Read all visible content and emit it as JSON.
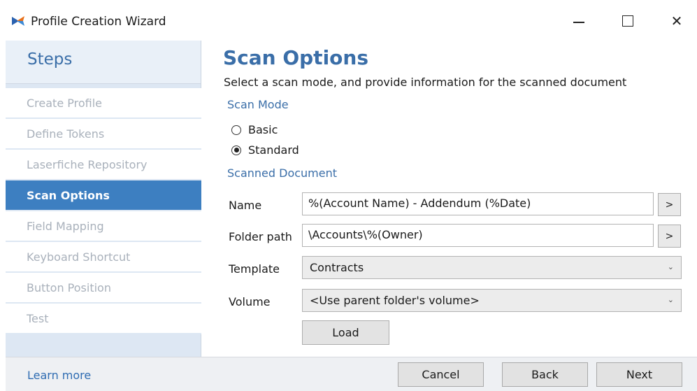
{
  "window": {
    "title": "Profile Creation Wizard",
    "icon": "laserfiche-logo-icon",
    "controls": [
      "minimize-icon",
      "maximize-icon",
      "close-icon"
    ],
    "close_glyph": "✕"
  },
  "steps": {
    "title": "Steps",
    "items": [
      {
        "label": "Create Profile",
        "active": false
      },
      {
        "label": "Define Tokens",
        "active": false
      },
      {
        "label": "Laserfiche Repository",
        "active": false
      },
      {
        "label": "Scan Options",
        "active": true
      },
      {
        "label": "Field Mapping",
        "active": false
      },
      {
        "label": "Keyboard Shortcut",
        "active": false
      },
      {
        "label": "Button Position",
        "active": false
      },
      {
        "label": "Test",
        "active": false
      }
    ]
  },
  "main": {
    "title": "Scan Options",
    "subtitle": "Select a scan mode, and provide information for the scanned document",
    "scan_mode": {
      "label": "Scan Mode",
      "options": [
        {
          "label": "Basic",
          "selected": false
        },
        {
          "label": "Standard",
          "selected": true
        }
      ]
    },
    "scanned_document": {
      "label": "Scanned Document",
      "name_label": "Name",
      "name_value": "%(Account Name) - Addendum (%Date)",
      "folder_label": "Folder path",
      "folder_value": "\\Accounts\\%(Owner)",
      "browse_glyph": ">",
      "template_label": "Template",
      "template_value": "Contracts",
      "volume_label": "Volume",
      "volume_value": "<Use parent folder's volume>",
      "dropdown_glyph": "⌄",
      "load_label": "Load"
    }
  },
  "footer": {
    "learn_more": "Learn more",
    "cancel": "Cancel",
    "back": "Back",
    "next": "Next"
  },
  "colors": {
    "accent": "#3a6ea8",
    "active_step": "#3d7fc1",
    "link": "#2f6cb2"
  }
}
